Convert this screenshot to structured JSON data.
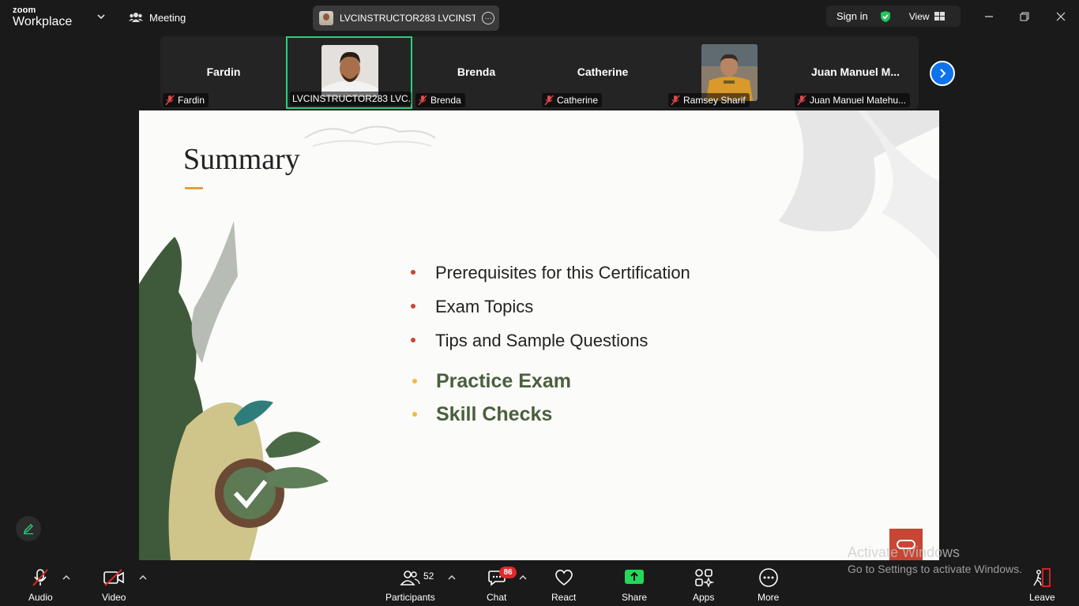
{
  "app": {
    "brand_top": "zoom",
    "brand_bottom": "Workplace",
    "meeting_label": "Meeting"
  },
  "speaker_pill": {
    "name": "LVCINSTRUCTOR283 LVCINSTRUC",
    "more_glyph": "···"
  },
  "header_right": {
    "signin": "Sign in",
    "view": "View"
  },
  "participants_strip": [
    {
      "big_name": "Fardin",
      "tag": "Fardin",
      "muted": true,
      "video": false,
      "active": false
    },
    {
      "big_name": "",
      "tag": "LVCINSTRUCTOR283 LVC...",
      "muted": false,
      "video": true,
      "active": true
    },
    {
      "big_name": "Brenda",
      "tag": "Brenda",
      "muted": true,
      "video": false,
      "active": false
    },
    {
      "big_name": "Catherine",
      "tag": "Catherine",
      "muted": true,
      "video": false,
      "active": false
    },
    {
      "big_name": "",
      "tag": "Ramsey Sharif",
      "muted": true,
      "video": true,
      "active": false
    },
    {
      "big_name": "Juan Manuel M...",
      "tag": "Juan Manuel Matehu...",
      "muted": true,
      "video": false,
      "active": false
    }
  ],
  "slide": {
    "title": "Summary",
    "bullets": [
      {
        "text": "Prerequisites for this Certification",
        "style": "normal"
      },
      {
        "text": "Exam Topics",
        "style": "normal"
      },
      {
        "text": "Tips and Sample Questions",
        "style": "normal"
      },
      {
        "text": "Practice Exam",
        "style": "highlight"
      },
      {
        "text": "Skill Checks",
        "style": "highlight"
      }
    ]
  },
  "watermark": {
    "line1": "Activate Windows",
    "line2": "Go to Settings to activate Windows."
  },
  "toolbar": {
    "audio": "Audio",
    "video": "Video",
    "participants": "Participants",
    "participants_count": "52",
    "chat": "Chat",
    "chat_badge": "86",
    "react": "React",
    "share": "Share",
    "apps": "Apps",
    "more": "More",
    "leave": "Leave"
  },
  "colors": {
    "accent_blue": "#0e72ed",
    "share_green": "#23d959",
    "active_border": "#2ad07e",
    "badge_red": "#e02828",
    "oracle_red": "#c74634",
    "bullet_green": "#4a5f3e"
  }
}
